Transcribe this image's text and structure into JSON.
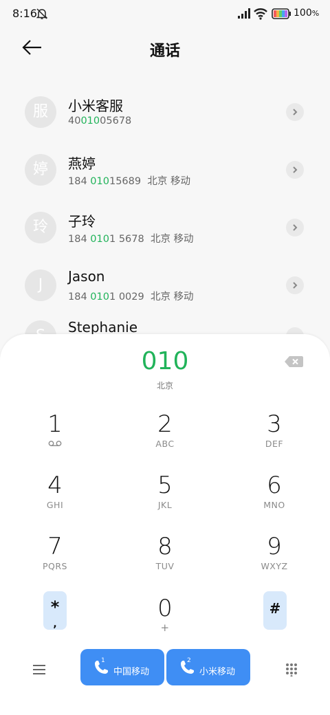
{
  "status_bar": {
    "time": "8:16",
    "battery_percent": "100",
    "battery_suffix": "%"
  },
  "header": {
    "title": "通话",
    "back_icon": "back-arrow-icon"
  },
  "contacts": [
    {
      "avatar": "服",
      "name": "小米客服",
      "num_pre": "40",
      "num_hl": "010",
      "num_post": "05678",
      "location": ""
    },
    {
      "avatar": "婷",
      "name": "燕婷",
      "num_pre": "184 ",
      "num_hl": "010",
      "num_post": "15689",
      "location": "北京 移动"
    },
    {
      "avatar": "玲",
      "name": "子玲",
      "num_pre": "184 ",
      "num_hl": "010",
      "num_post": "1 5678",
      "location": "北京 移动"
    },
    {
      "avatar": "J",
      "name": "Jason",
      "num_pre": "184 ",
      "num_hl": "010",
      "num_post": "1 0029",
      "location": "北京 移动"
    },
    {
      "avatar": "S",
      "name": "Stephanie",
      "num_pre": "",
      "num_hl": "",
      "num_post": "",
      "location": ""
    }
  ],
  "dialer": {
    "number": "010",
    "location": "北京",
    "keys": [
      {
        "digit": "1",
        "letters": ""
      },
      {
        "digit": "2",
        "letters": "ABC"
      },
      {
        "digit": "3",
        "letters": "DEF"
      },
      {
        "digit": "4",
        "letters": "GHI"
      },
      {
        "digit": "5",
        "letters": "JKL"
      },
      {
        "digit": "6",
        "letters": "MNO"
      },
      {
        "digit": "7",
        "letters": "PQRS"
      },
      {
        "digit": "8",
        "letters": "TUV"
      },
      {
        "digit": "9",
        "letters": "WXYZ"
      },
      {
        "digit": "*",
        "letters": ","
      },
      {
        "digit": "0",
        "letters": "+"
      },
      {
        "digit": "#",
        "letters": ""
      }
    ]
  },
  "bottom_bar": {
    "call_sim1": {
      "sim": "1",
      "label": "中国移动"
    },
    "call_sim2": {
      "sim": "2",
      "label": "小米移动"
    }
  },
  "colors": {
    "accent_green": "#21b35a",
    "call_blue": "#3f8ef4",
    "symbol_key_bg": "#d8e9fb"
  }
}
